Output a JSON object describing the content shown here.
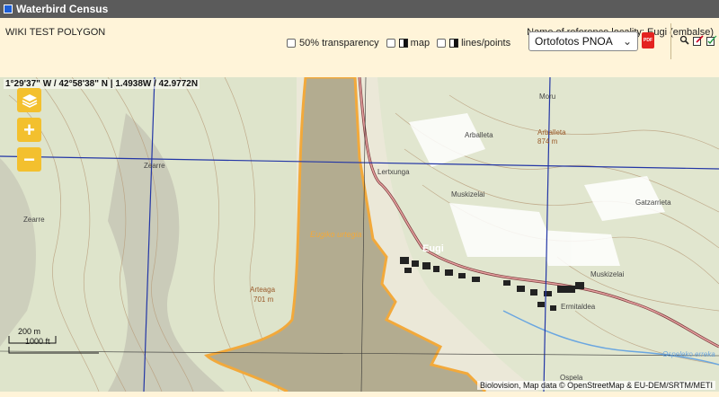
{
  "window": {
    "title": "Waterbird Census"
  },
  "info": {
    "polygon_name": "WIKI TEST POLYGON",
    "reference_locality": "Name of reference locality: Eugi (embalse)"
  },
  "controls": {
    "transparency_label": "50% transparency",
    "map_label": "map",
    "lines_label": "lines/points",
    "basemap_selected": "Ortofotos PNOA",
    "pdf_label": "PDF"
  },
  "map": {
    "coordinates": "1°29'37\" W / 42°58'38\" N | 1.4938W / 42.9772N",
    "zoom_in": "+",
    "zoom_out": "−",
    "scale_top": "200 m",
    "scale_bottom": "1000 ft",
    "attribution": "Biolovision, Map data © OpenStreetMap & EU-DEM/SRTM/METI",
    "labels": {
      "moru": "Moru",
      "arballeta": "Arballeta",
      "arballeta_peak": "Arballeta",
      "arballeta_elev": "874 m",
      "zearre1": "Zearre",
      "zearre2": "Zearre",
      "lertxunga": "Lertxunga",
      "muskizelai1": "Muskizelai",
      "gatzarrieta": "Gatzarrieta",
      "lake": "Eugiko urtegia",
      "eugi": "Eugi",
      "muskizelai2": "Muskizelai",
      "ermitaldea": "Ermitaldea",
      "arteaga": "Arteaga",
      "arteaga_elev": "701 m",
      "ospeleko": "Ospeleko erreka",
      "ospela": "Ospela"
    }
  },
  "colors": {
    "accent_yellow": "#f3c02e",
    "polygon_orange": "#f2a93b",
    "grid_blue": "#2336a6"
  }
}
